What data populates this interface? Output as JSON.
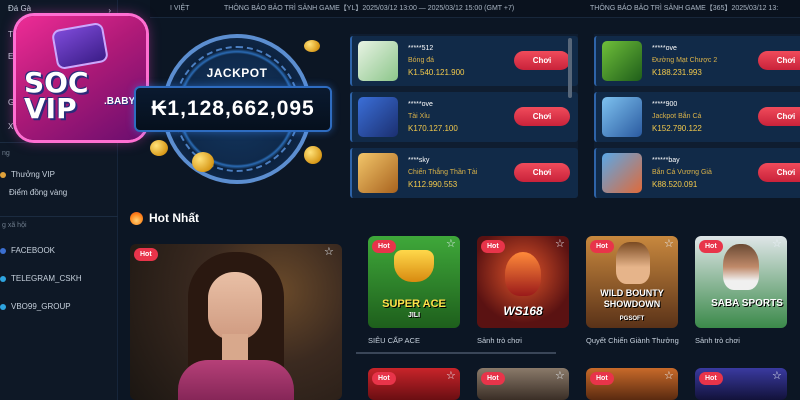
{
  "sidebar": {
    "items": [
      {
        "label": "Đá Gà"
      },
      {
        "label": "Th"
      },
      {
        "label": "E"
      },
      {
        "label": "Ga"
      },
      {
        "label": "XS"
      }
    ],
    "section_partial": "ng",
    "promo_items": [
      {
        "label": "Thưởng VIP"
      },
      {
        "label": "Điểm đồng vàng"
      }
    ],
    "contact_section": "g xã hội",
    "contact_items": [
      {
        "label": "FACEBOOK"
      },
      {
        "label": "TELEGRAM_CSKH"
      },
      {
        "label": "VBO99_GROUP"
      }
    ],
    "chevron": "›"
  },
  "logo": {
    "text": "SOC VIP",
    "sub": ".BABY"
  },
  "marquee": {
    "lang_partial": "I VIỆT",
    "notice1": "THÔNG BÁO BẢO TRÌ SẢNH GAME【YL】2025/03/12 13:00 — 2025/03/12 15:00 (GMT +7)",
    "notice2": "THÔNG BÁO BẢO TRÌ SẢNH GAME【365】2025/03/12 13:"
  },
  "jackpot": {
    "label": "JACKPOT",
    "value": "₭1,128,662,095"
  },
  "winners_left": [
    {
      "name": "*****512",
      "game": "Bóng đá",
      "amount": "K1.540.121.900",
      "button": "Chơi",
      "thumb_color": "#2e7d3a"
    },
    {
      "name": "*****ove",
      "game": "Tài Xỉu",
      "amount": "K170.127.100",
      "button": "Chơi",
      "thumb_color": "#2a4fa0"
    },
    {
      "name": "****sky",
      "game": "Chiến Thắng Thần Tài",
      "amount": "K112.990.553",
      "button": "Chơi",
      "thumb_color": "#a8781e"
    }
  ],
  "winners_right": [
    {
      "name": "*****ove",
      "game": "Đường Mạt Chược 2",
      "amount": "K188.231.993",
      "button": "Chơi",
      "thumb_color": "#3a7a2a"
    },
    {
      "name": "*****900",
      "game": "Jackpot Bắn Cá",
      "amount": "K152.790.122",
      "button": "Chơi",
      "thumb_color": "#2d5fa8"
    },
    {
      "name": "******bay",
      "game": "Bắn Cá Vương Giả",
      "amount": "K88.520.091",
      "button": "Chơi",
      "thumb_color": "#3a6ec0"
    }
  ],
  "hot": {
    "title": "Hot Nhất",
    "badge": "Hot",
    "star": "☆",
    "tiles": [
      {
        "title": "SUPER ACE",
        "provider": "JILI",
        "label": "SIÊU CẤP ACE",
        "bg": "#2c8b2a"
      },
      {
        "title": "WS168",
        "provider": "",
        "label": "Sảnh trò chơi",
        "bg": "#7a1a1a"
      },
      {
        "title": "WILD BOUNTY SHOWDOWN",
        "provider": "PGSOFT",
        "label": "Quyết Chiến Giành Thưởng",
        "bg": "#8a5a2a"
      },
      {
        "title": "SABA SPORTS",
        "provider": "",
        "label": "Sảnh trò chơi",
        "bg": "#2a7a3a"
      }
    ],
    "bottom_tiles": [
      {
        "bg": "#8a1a1a"
      },
      {
        "bg": "#6a5a4a"
      },
      {
        "bg": "#7a3a1a"
      },
      {
        "bg": "#2a2a6a"
      }
    ]
  }
}
